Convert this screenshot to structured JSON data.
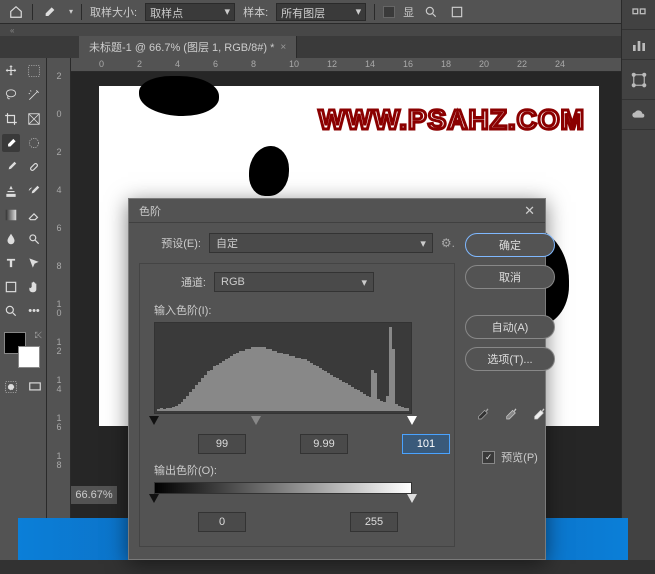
{
  "topbar": {
    "sample_size_label": "取样大小:",
    "sample_size_value": "取样点",
    "sample_label": "样本:",
    "sample_value": "所有图层",
    "show_label": "显"
  },
  "doc_tab": {
    "title": "未标题-1 @ 66.7% (图层 1, RGB/8#) *"
  },
  "hruler": [
    "0",
    "2",
    "4",
    "6",
    "8",
    "10",
    "12",
    "14",
    "16",
    "18",
    "20",
    "22",
    "24"
  ],
  "vruler": [
    "2",
    "0",
    "2",
    "4",
    "6",
    "8",
    "10",
    "12",
    "14",
    "16",
    "18"
  ],
  "canvas": {
    "watermark": "WWW.PSAHZ.COM"
  },
  "status": {
    "zoom": "66.67%"
  },
  "dialog": {
    "title": "色阶",
    "preset_label": "预设(E):",
    "preset_value": "自定",
    "channel_label": "通道:",
    "channel_value": "RGB",
    "input_levels_label": "输入色阶(I):",
    "output_levels_label": "输出色阶(O):",
    "in_black": "99",
    "in_gamma": "9.99",
    "in_white": "101",
    "out_black": "0",
    "out_white": "255",
    "ok": "确定",
    "cancel": "取消",
    "auto": "自动(A)",
    "options": "选项(T)...",
    "preview": "预览(P)"
  },
  "chart_data": {
    "type": "bar",
    "title": "输入色阶(I):",
    "xlabel": "",
    "ylabel": "",
    "categories_range": [
      0,
      255
    ],
    "input_black": 99,
    "input_gamma": 9.99,
    "input_white": 101,
    "output_black": 0,
    "output_white": 255,
    "histogram": [
      2,
      3,
      2,
      4,
      3,
      5,
      6,
      8,
      10,
      14,
      18,
      22,
      26,
      30,
      34,
      38,
      42,
      46,
      48,
      52,
      54,
      56,
      58,
      60,
      62,
      64,
      66,
      68,
      70,
      70,
      72,
      72,
      74,
      74,
      74,
      74,
      74,
      72,
      72,
      70,
      70,
      68,
      68,
      66,
      66,
      64,
      64,
      62,
      62,
      60,
      60,
      58,
      56,
      54,
      52,
      50,
      48,
      46,
      44,
      42,
      40,
      38,
      36,
      34,
      32,
      30,
      28,
      26,
      24,
      22,
      20,
      18,
      16,
      48,
      44,
      14,
      12,
      10,
      18,
      98,
      72,
      8,
      6,
      5,
      4,
      3
    ]
  }
}
